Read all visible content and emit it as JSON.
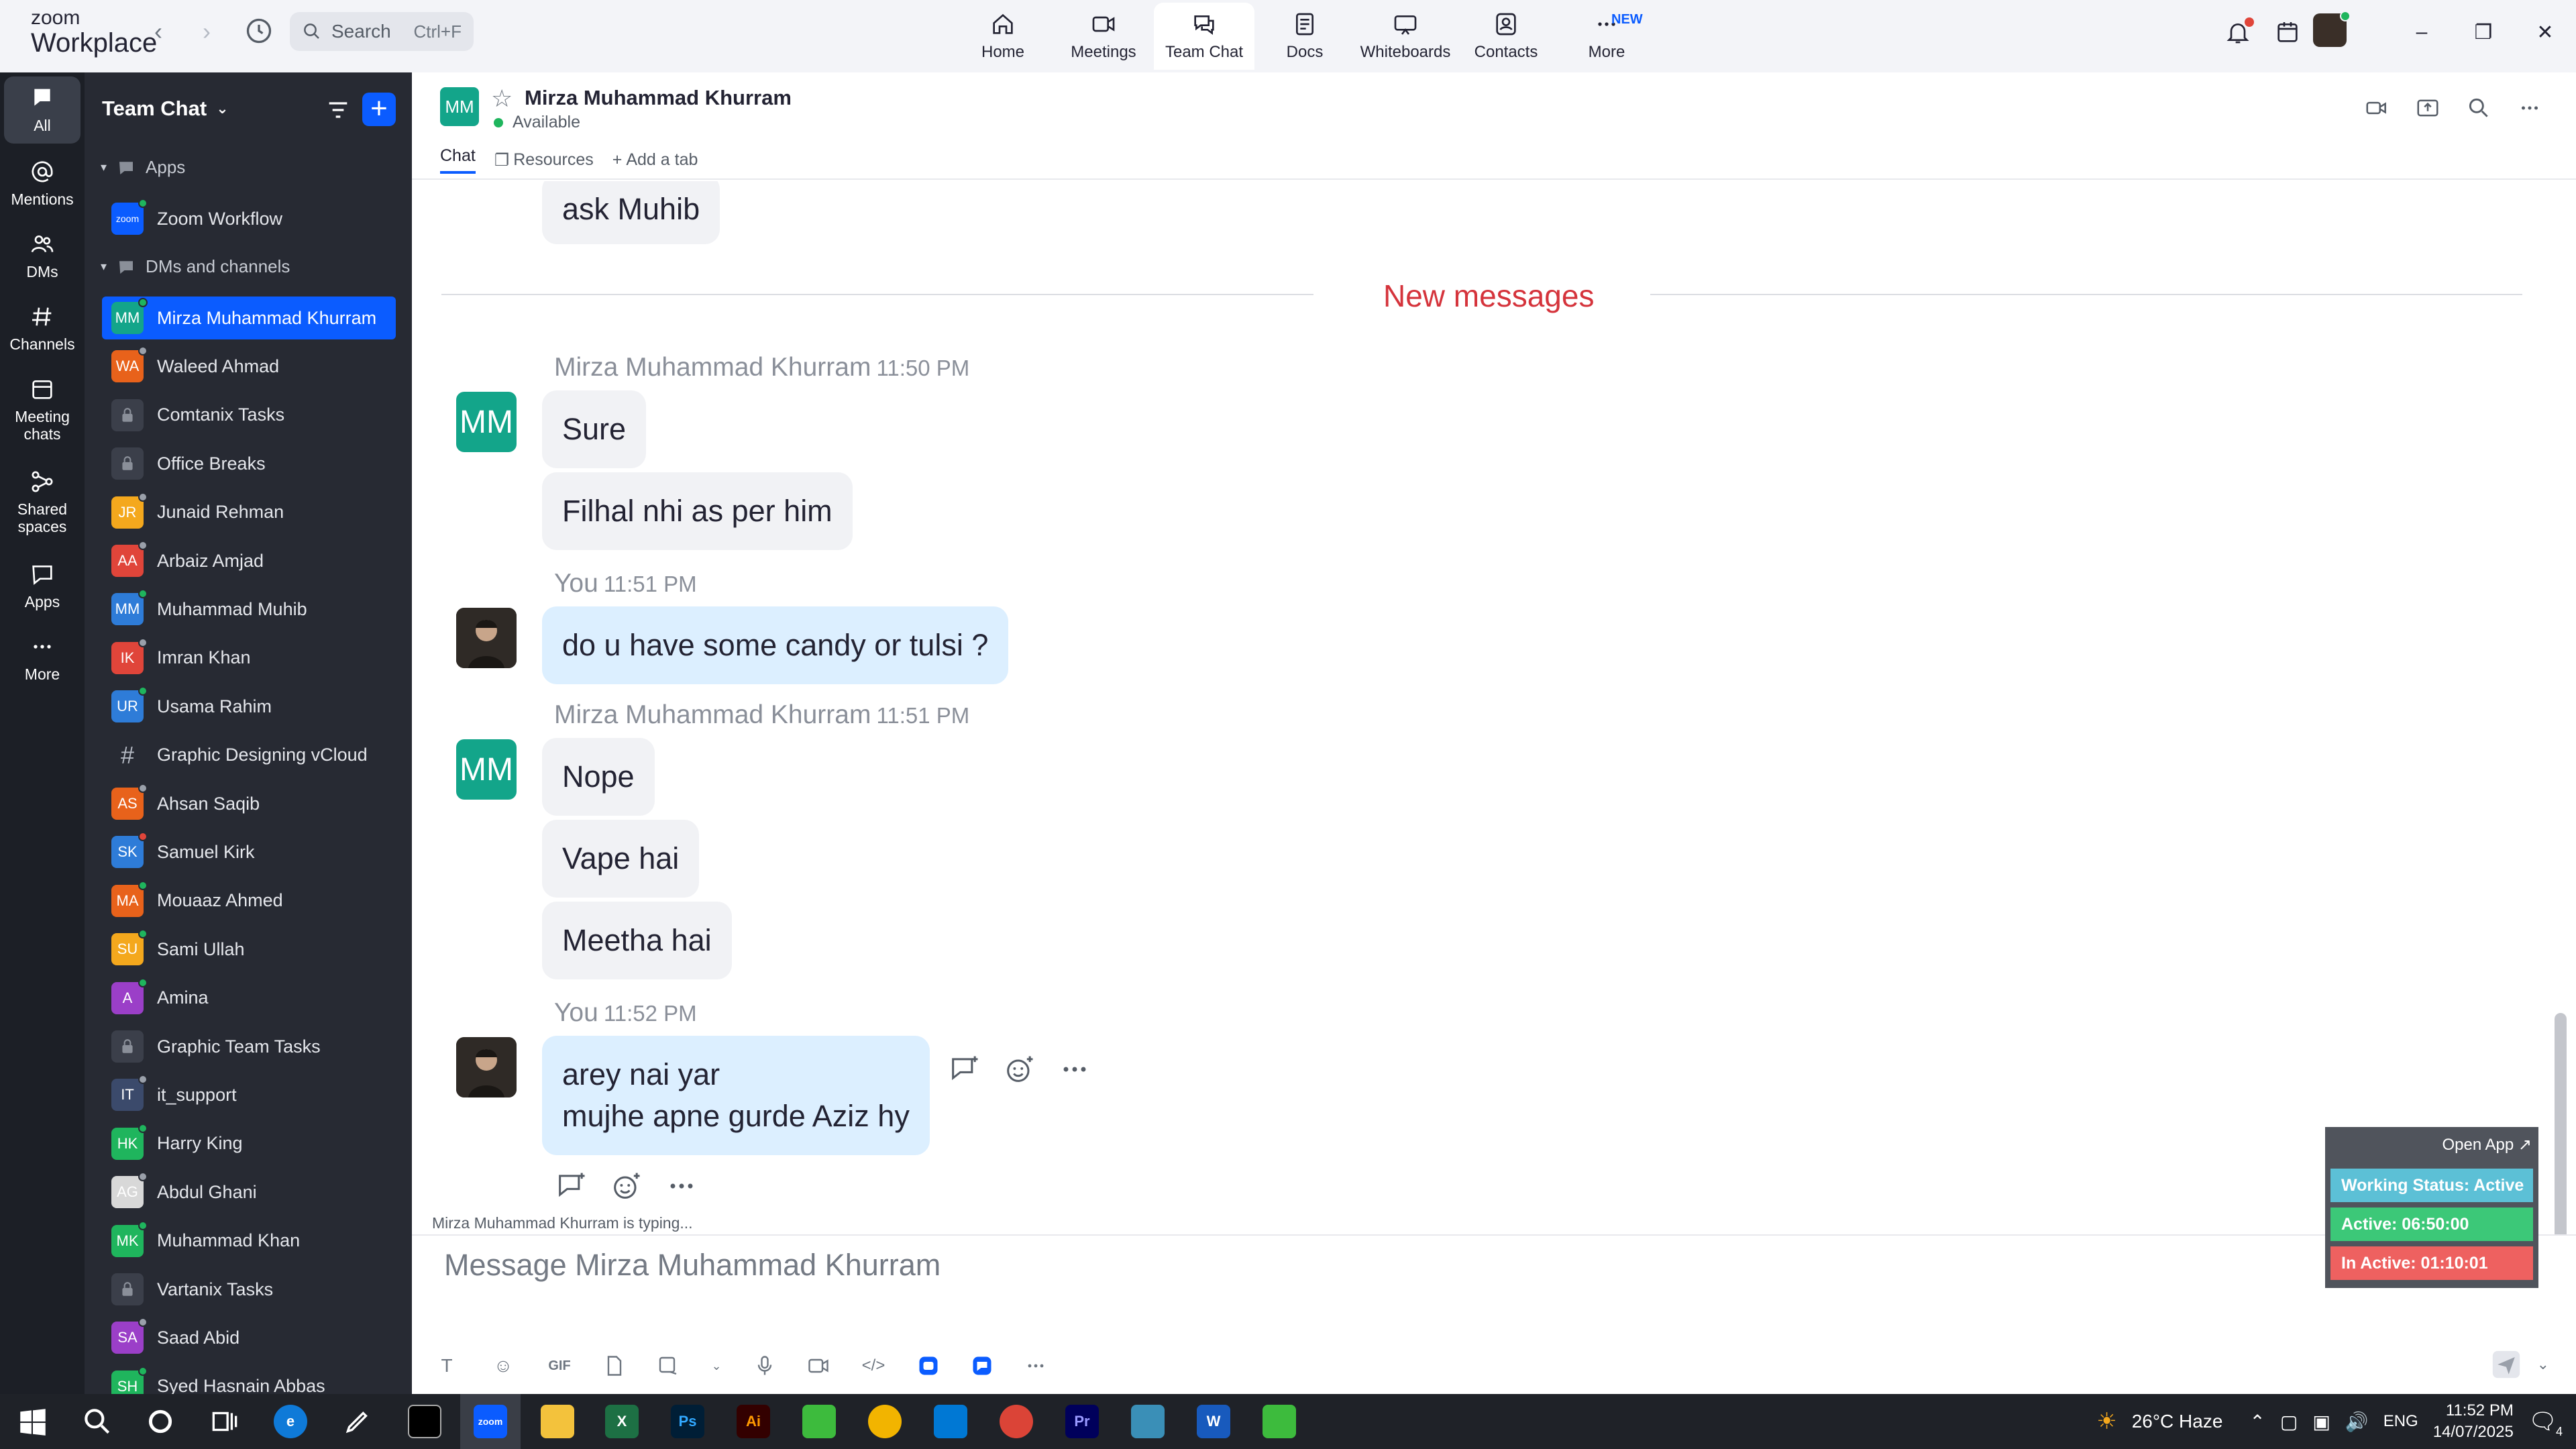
{
  "app": {
    "brand_top": "zoom",
    "brand_bottom": "Workplace"
  },
  "search": {
    "placeholder": "Search",
    "shortcut": "Ctrl+F"
  },
  "nav": {
    "items": [
      {
        "label": "Home",
        "icon": "home-icon"
      },
      {
        "label": "Meetings",
        "icon": "video-icon"
      },
      {
        "label": "Team Chat",
        "icon": "chat-icon",
        "active": true
      },
      {
        "label": "Docs",
        "icon": "doc-icon"
      },
      {
        "label": "Whiteboards",
        "icon": "whiteboard-icon"
      },
      {
        "label": "Contacts",
        "icon": "contacts-icon"
      },
      {
        "label": "More",
        "icon": "more-icon",
        "badge": "NEW"
      }
    ]
  },
  "rail": {
    "items": [
      {
        "label": "All",
        "icon": "chat-bubble-icon"
      },
      {
        "label": "Mentions",
        "icon": "at-icon"
      },
      {
        "label": "DMs",
        "icon": "people-icon"
      },
      {
        "label": "Channels",
        "icon": "hash-icon"
      },
      {
        "label": "Meeting chats",
        "icon": "calendar-icon"
      },
      {
        "label": "Shared spaces",
        "icon": "shared-icon"
      },
      {
        "label": "Apps",
        "icon": "apps-icon"
      },
      {
        "label": "More",
        "icon": "ellipsis-icon"
      }
    ]
  },
  "sidebar": {
    "title": "Team Chat",
    "sections": {
      "apps": "Apps",
      "dms": "DMs and channels"
    },
    "apps": [
      {
        "name": "Zoom Workflow",
        "initials": "zoom"
      }
    ],
    "items": [
      {
        "name": "Mirza Muhammad Khurram",
        "initials": "MM",
        "color": "#13a58a",
        "type": "dm",
        "active": true,
        "presence": "#1fb55d"
      },
      {
        "name": "Waleed Ahmad",
        "initials": "WA",
        "color": "#e8621b",
        "type": "dm",
        "presence": "#9aa0aa"
      },
      {
        "name": "Comtanix Tasks",
        "type": "private"
      },
      {
        "name": "Office Breaks",
        "type": "private"
      },
      {
        "name": "Junaid Rehman",
        "initials": "JR",
        "color": "#f4a81d",
        "type": "dm",
        "presence": "#9aa0aa"
      },
      {
        "name": "Arbaiz Amjad",
        "initials": "AA",
        "color": "#e0453a",
        "type": "dm",
        "presence": "#9aa0aa"
      },
      {
        "name": "Muhammad Muhib",
        "initials": "MM",
        "color": "#2e7cd8",
        "type": "dm",
        "presence": "#1fb55d"
      },
      {
        "name": "Imran Khan",
        "initials": "IK",
        "color": "#e0453a",
        "type": "dm",
        "presence": "#9aa0aa"
      },
      {
        "name": "Usama Rahim",
        "initials": "UR",
        "color": "#2e7cd8",
        "type": "dm",
        "presence": "#1fb55d"
      },
      {
        "name": "Graphic Designing vCloud",
        "type": "channel"
      },
      {
        "name": "Ahsan Saqib",
        "initials": "AS",
        "color": "#e8621b",
        "type": "dm",
        "presence": "#9aa0aa"
      },
      {
        "name": "Samuel Kirk",
        "initials": "SK",
        "color": "#2e7cd8",
        "type": "dm",
        "presence": "#e0453a"
      },
      {
        "name": "Mouaaz Ahmed",
        "initials": "MA",
        "color": "#e8621b",
        "type": "dm",
        "presence": "#1fb55d"
      },
      {
        "name": "Sami Ullah",
        "initials": "SU",
        "color": "#f4a81d",
        "type": "dm",
        "presence": "#1fb55d"
      },
      {
        "name": "Amina",
        "initials": "A",
        "color": "#9b3fc8",
        "type": "dm",
        "presence": "#1fb55d"
      },
      {
        "name": "Graphic Team Tasks",
        "type": "private"
      },
      {
        "name": "it_support",
        "initials": "IT",
        "color": "#3b4a6b",
        "type": "dm",
        "presence": "#9aa0aa"
      },
      {
        "name": "Harry King",
        "initials": "HK",
        "color": "#1fb55d",
        "type": "dm",
        "presence": "#1fb55d"
      },
      {
        "name": "Abdul Ghani",
        "initials": "AG",
        "color": "#d8d8d8",
        "type": "dm",
        "presence": "#9aa0aa"
      },
      {
        "name": "Muhammad Khan",
        "initials": "MK",
        "color": "#1fb55d",
        "type": "dm",
        "presence": "#1fb55d"
      },
      {
        "name": "Vartanix Tasks",
        "type": "private"
      },
      {
        "name": "Saad Abid",
        "initials": "SA",
        "color": "#9b3fc8",
        "type": "dm",
        "presence": "#9aa0aa"
      },
      {
        "name": "Syed Hasnain Abbas",
        "initials": "SH",
        "color": "#1fb55d",
        "type": "dm",
        "presence": "#1fb55d"
      }
    ]
  },
  "chat": {
    "contact_initials": "MM",
    "contact_name": "Mirza Muhammad Khurram",
    "status": "Available",
    "tabs": {
      "chat": "Chat",
      "resources": "Resources",
      "add": "Add a tab"
    },
    "new_messages_label": "New messages",
    "prev_message": "ask Muhib",
    "groups": [
      {
        "sender": "Mirza Muhammad Khurram",
        "time": "11:50 PM",
        "messages": [
          "Sure",
          "Filhal nhi as per him"
        ]
      },
      {
        "sender": "You",
        "time": "11:51 PM",
        "messages": [
          "do u have some candy or tulsi ?"
        ]
      },
      {
        "sender": "Mirza Muhammad Khurram",
        "time": "11:51 PM",
        "messages": [
          "Nope",
          "Vape hai",
          "Meetha hai"
        ]
      },
      {
        "sender": "You",
        "time": "11:52 PM",
        "messages": [
          "arey nai yar",
          "mujhe apne gurde Aziz hy"
        ]
      }
    ],
    "typing": "Mirza Muhammad Khurram  is typing...",
    "composer_placeholder": "Message Mirza Muhammad Khurram"
  },
  "widget": {
    "open_app": "Open App ↗",
    "working_status": "Working Status: Active",
    "active": "Active: 06:50:00",
    "inactive": "In Active: 01:10:01",
    "colors": {
      "working": "#5cc0d6",
      "active": "#3cc878",
      "inactive": "#ee6160"
    }
  },
  "taskbar": {
    "weather": "26°C  Haze",
    "lang": "ENG",
    "time": "11:52 PM",
    "date": "14/07/2025",
    "notification_count": "4"
  },
  "colors": {
    "accent": "#0b5cff",
    "sidebar_bg": "#272a33",
    "rail_bg": "#1c1f26"
  }
}
